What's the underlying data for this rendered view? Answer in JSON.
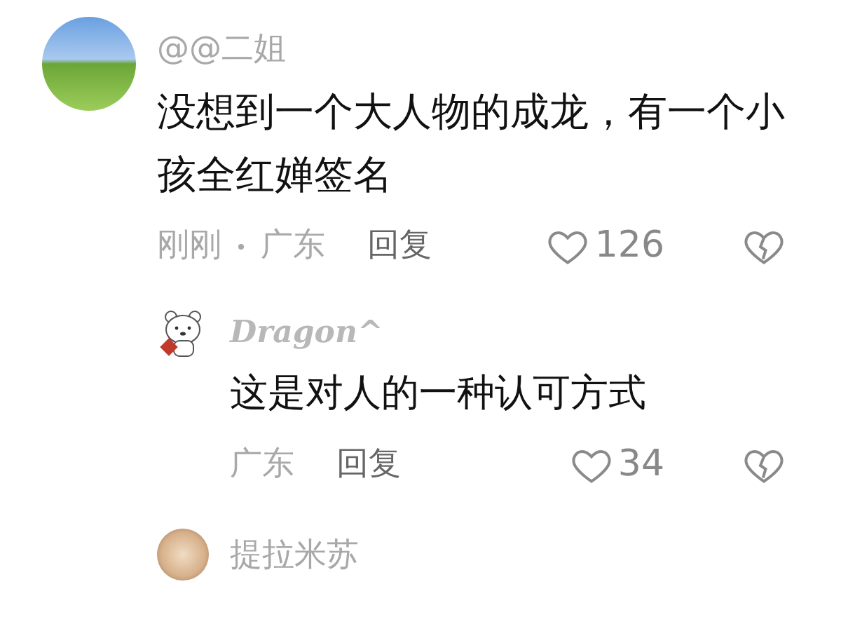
{
  "comments": [
    {
      "username": {
        "text": "@@二姐",
        "kind": "plain"
      },
      "avatar": {
        "kind": "photo"
      },
      "text": "没想到一个大人物的成龙，有一个小孩全红婵签名",
      "time": "刚刚",
      "location": "广东",
      "reply_label": "回复",
      "likes": "126",
      "liked": false,
      "children": [
        {
          "username": {
            "text": "Dragon^",
            "kind": "fancy"
          },
          "avatar": {
            "kind": "cartoon"
          },
          "text": "这是对人的一种认可方式",
          "location": "广东",
          "reply_label": "回复",
          "likes": "34",
          "liked": false
        },
        {
          "username": {
            "text": "提拉米苏",
            "kind": "plain"
          },
          "avatar": {
            "kind": "photo"
          }
        }
      ]
    }
  ]
}
